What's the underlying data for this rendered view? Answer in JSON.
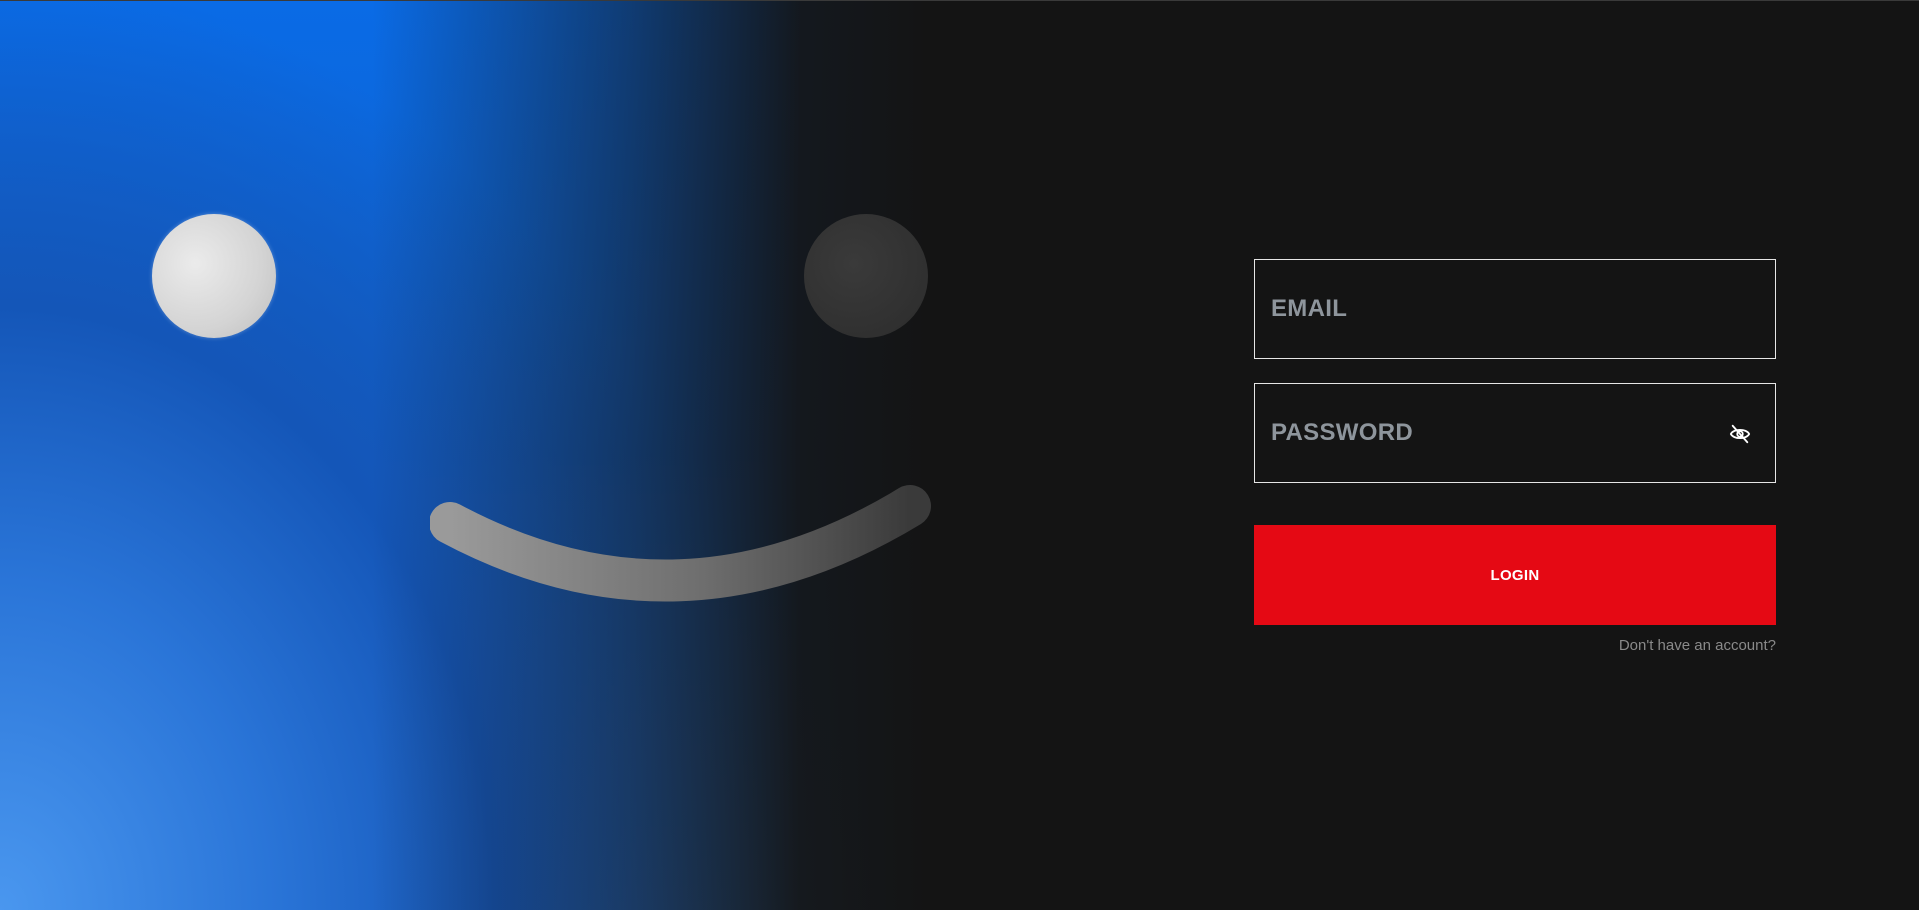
{
  "hero": {
    "colors": {
      "blue_top": "#0a6be6",
      "blue_bottom": "#4a97ef",
      "eye_left": "#d4d4d4",
      "eye_right": "#303030",
      "smile": "#6b6b6b"
    }
  },
  "login_form": {
    "email": {
      "placeholder": "EMAIL",
      "value": ""
    },
    "password": {
      "placeholder": "PASSWORD",
      "value": "",
      "toggle_icon": "eye-off-icon"
    },
    "submit_label": "LOGIN",
    "signup_link": "Don't have an account?"
  },
  "colors": {
    "background": "#141414",
    "accent": "#e50914",
    "field_border": "#e6e6e6",
    "placeholder": "#8e959c",
    "muted_text": "#8a8a8a"
  }
}
